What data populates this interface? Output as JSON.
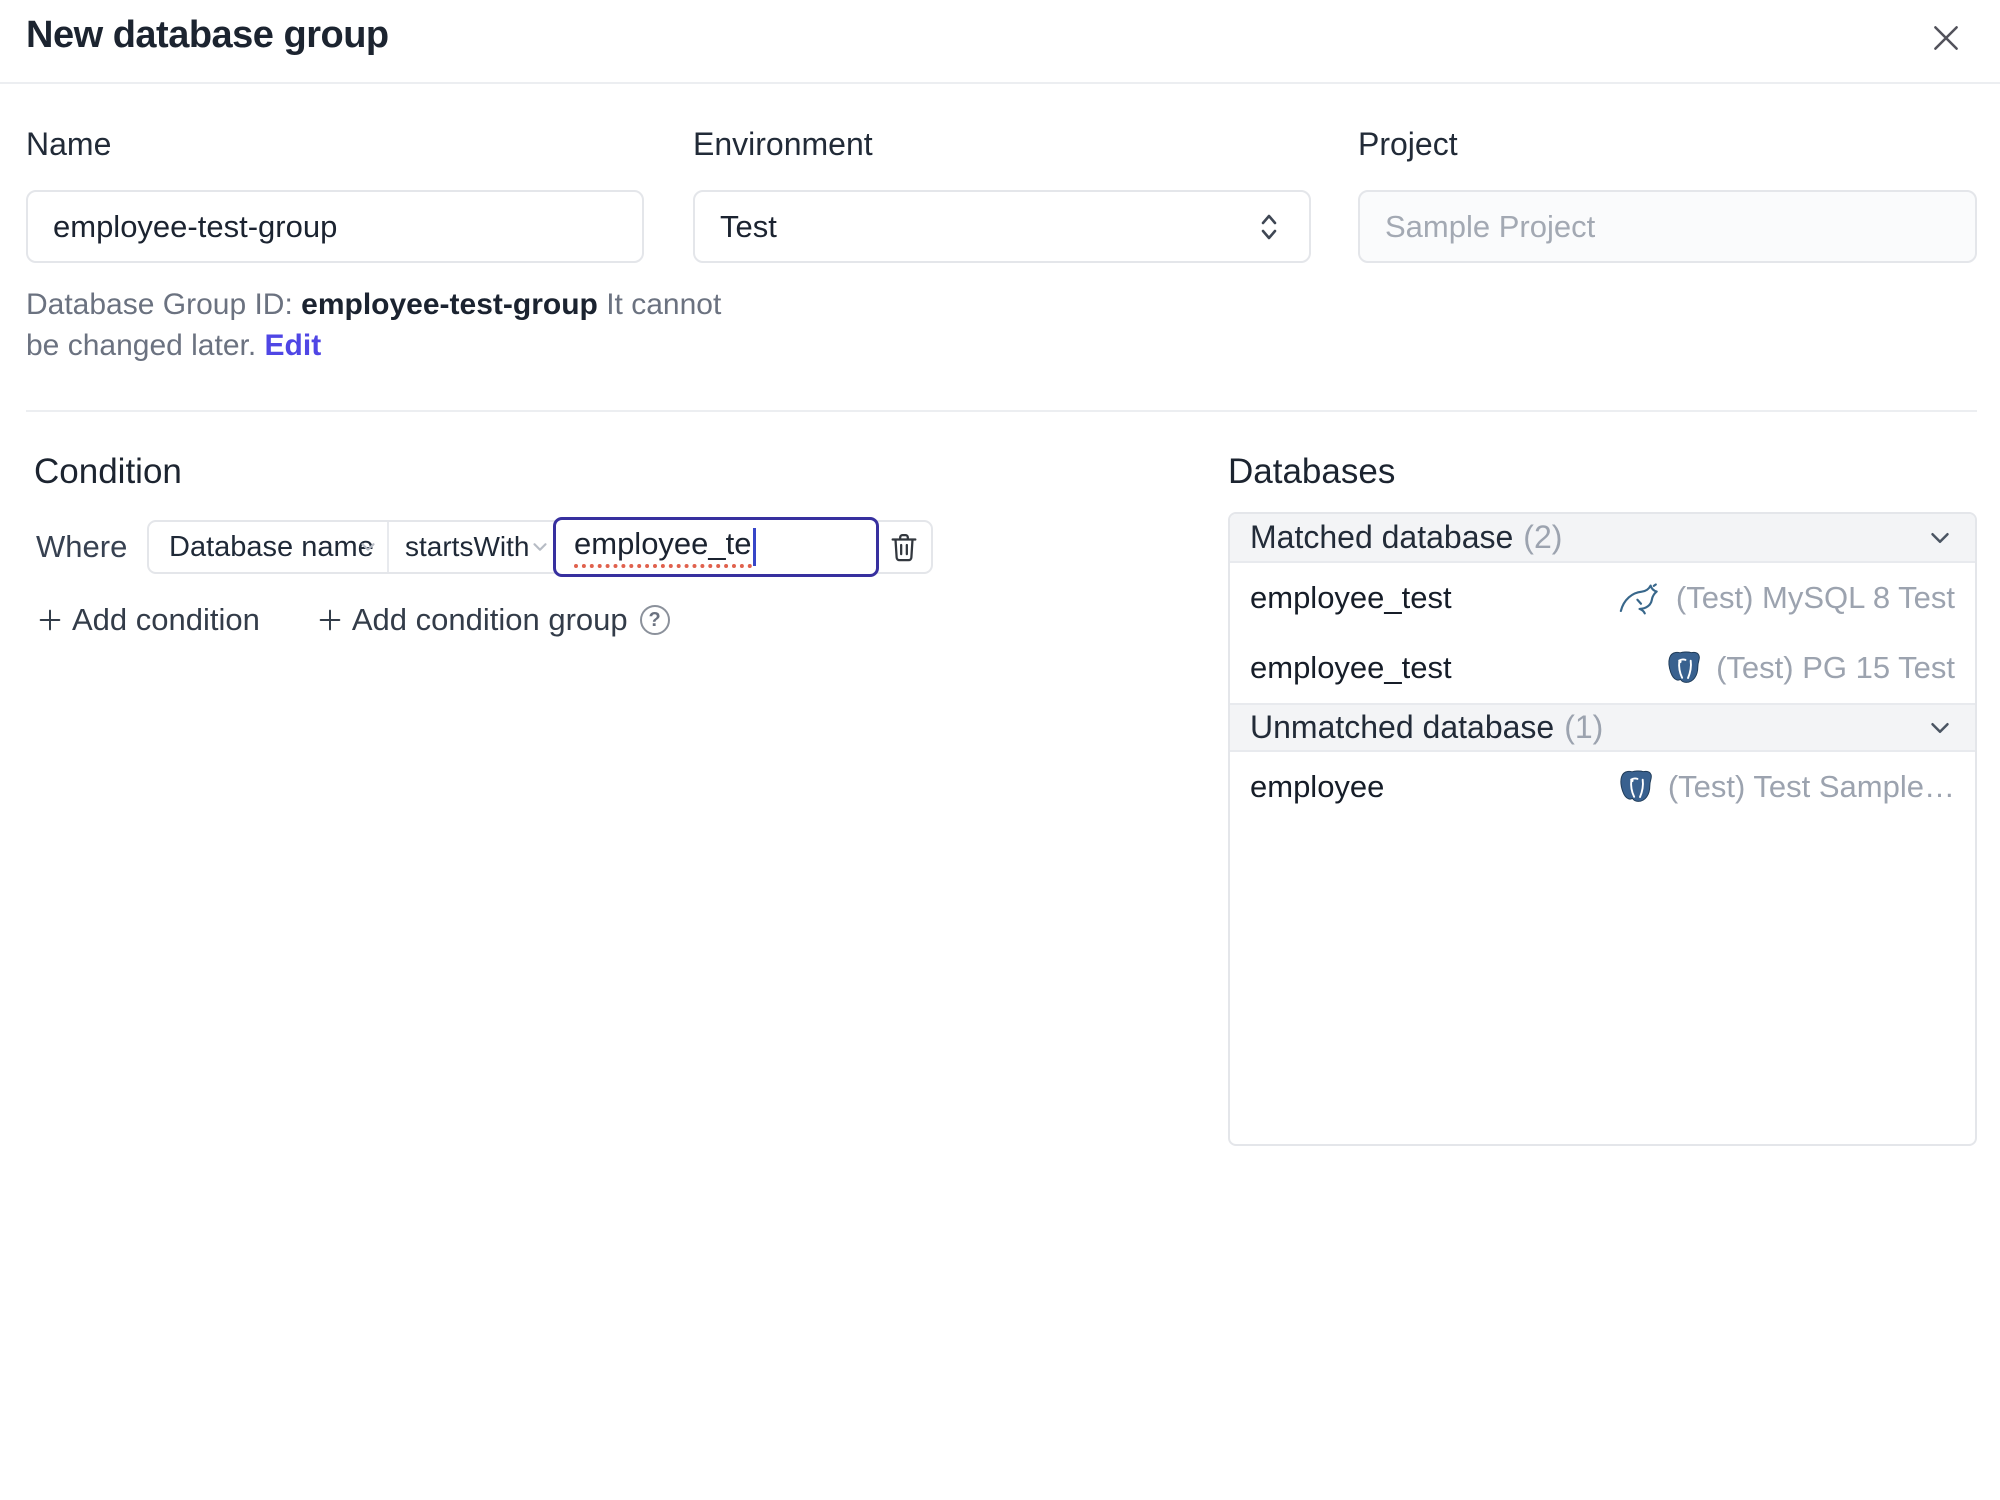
{
  "dialog": {
    "title": "New database group"
  },
  "form": {
    "name_label": "Name",
    "name_value": "employee-test-group",
    "environment_label": "Environment",
    "environment_value": "Test",
    "project_label": "Project",
    "project_value": "Sample Project",
    "id_note_prefix": "Database Group ID:",
    "id_note_id": "employee-test-group",
    "id_note_suffix": "It cannot be changed later.",
    "id_note_edit": "Edit"
  },
  "condition": {
    "heading": "Condition",
    "where_label": "Where",
    "field_selected": "Database name",
    "operator_selected": "startsWith",
    "value": "employee_te",
    "add_condition": "Add condition",
    "add_condition_group": "Add condition group",
    "help_glyph": "?"
  },
  "databases": {
    "heading": "Databases",
    "groups": [
      {
        "title": "Matched database",
        "count": "(2)",
        "rows": [
          {
            "name": "employee_test",
            "engine": "mysql",
            "instance": "(Test) MySQL 8 Test"
          },
          {
            "name": "employee_test",
            "engine": "postgresql",
            "instance": "(Test) PG 15 Test"
          }
        ]
      },
      {
        "title": "Unmatched database",
        "count": "(1)",
        "rows": [
          {
            "name": "employee",
            "engine": "postgresql",
            "instance": "(Test) Test Sample…"
          }
        ]
      }
    ]
  },
  "colors": {
    "accent_link": "#4f46e5",
    "focused_input_border": "#37309f",
    "postgres_blue": "#39618f",
    "mysql_teal": "#38678b",
    "panel_header_bg": "#f3f4f6",
    "muted_text": "#9ca3af"
  }
}
